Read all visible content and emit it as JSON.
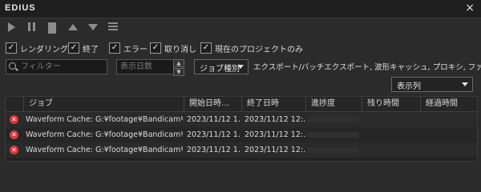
{
  "window": {
    "title": "EDIUS",
    "close": "×"
  },
  "toolbar": {
    "play": "play-icon",
    "pause": "pause-icon",
    "delete": "trash-icon",
    "up": "arrow-up-icon",
    "down": "arrow-down-icon",
    "list": "list-icon"
  },
  "filters": [
    {
      "label": "レンダリング中",
      "checked": true
    },
    {
      "label": "終了",
      "checked": true
    },
    {
      "label": "エラー",
      "checked": true
    },
    {
      "label": "取り消し",
      "checked": true
    },
    {
      "label": "現在のプロジェクトのみ",
      "checked": true
    }
  ],
  "search": {
    "placeholder": "フィルター",
    "value": ""
  },
  "days": {
    "placeholder": "表示日数",
    "value": ""
  },
  "job_type": {
    "label": "ジョブ種別"
  },
  "job_type_desc": "エクスポート/バッチエクスポート, 波形キャッシュ, プロキシ, ファ…",
  "columns_dropdown": {
    "label": "表示列"
  },
  "table": {
    "headers": [
      "ジョブ",
      "開始日時…",
      "終了日時",
      "進捗度",
      "残り時間",
      "経過時間"
    ],
    "rows": [
      {
        "job": "Waveform Cache: G:¥footage¥Bandicam¥その他¥…",
        "start": "2023/11/12 1…",
        "end": "2023/11/12 12:…",
        "status": "error"
      },
      {
        "job": "Waveform Cache: G:¥footage¥Bandicam¥その他¥…",
        "start": "2023/11/12 1…",
        "end": "2023/11/12 12:…",
        "status": "error"
      },
      {
        "job": "Waveform Cache: G:¥footage¥Bandicam¥その他¥…",
        "start": "2023/11/12 1…",
        "end": "2023/11/12 12:…",
        "status": "error"
      }
    ]
  }
}
